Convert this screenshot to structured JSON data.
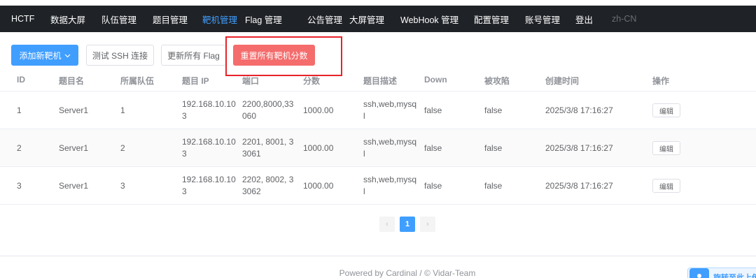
{
  "nav": {
    "brand": "HCTF",
    "items": [
      {
        "label": "数据大屏"
      },
      {
        "label": "队伍管理"
      },
      {
        "label": "题目管理"
      },
      {
        "label": "靶机管理"
      },
      {
        "label": "Flag 管理"
      },
      {
        "label": "公告管理"
      },
      {
        "label": "大屏管理"
      },
      {
        "label": "WebHook 管理"
      },
      {
        "label": "配置管理"
      },
      {
        "label": "账号管理"
      },
      {
        "label": "登出"
      }
    ],
    "active_index": 3,
    "lang": "zh-CN"
  },
  "toolbar": {
    "add_label": "添加新靶机",
    "test_ssh_label": "测试 SSH 连接",
    "update_flags_label": "更新所有 Flag",
    "reset_scores_label": "重置所有靶机分数"
  },
  "table": {
    "headers": [
      "ID",
      "题目名",
      "所属队伍",
      "题目 IP",
      "端口",
      "分数",
      "题目描述",
      "Down",
      "被攻陷",
      "创建时间",
      "操作"
    ],
    "rows": [
      {
        "id": "1",
        "name": "Server1",
        "team": "1",
        "ip_l1": "192.168.10.10",
        "ip_l2": "3",
        "port_l1": "2200,8000,33",
        "port_l2": "060",
        "score": "1000.00",
        "desc_l1": "ssh,web,mysq",
        "desc_l2": "l",
        "down": "false",
        "attacked": "false",
        "created": "2025/3/8 17:16:27",
        "action": "编辑"
      },
      {
        "id": "2",
        "name": "Server1",
        "team": "2",
        "ip_l1": "192.168.10.10",
        "ip_l2": "3",
        "port_l1": "2201, 8001, 3",
        "port_l2": "3061",
        "score": "1000.00",
        "desc_l1": "ssh,web,mysq",
        "desc_l2": "l",
        "down": "false",
        "attacked": "false",
        "created": "2025/3/8 17:16:27",
        "action": "编辑"
      },
      {
        "id": "3",
        "name": "Server1",
        "team": "3",
        "ip_l1": "192.168.10.10",
        "ip_l2": "3",
        "port_l1": "2202, 8002, 3",
        "port_l2": "3062",
        "score": "1000.00",
        "desc_l1": "ssh,web,mysq",
        "desc_l2": "l",
        "down": "false",
        "attacked": "false",
        "created": "2025/3/8 17:16:27",
        "action": "编辑"
      }
    ]
  },
  "pagination": {
    "prev": "‹",
    "current": "1",
    "next": "›"
  },
  "footer": {
    "text": "Powered by Cardinal / © Vidar-Team"
  },
  "floating": {
    "label": "旋转至此上传"
  },
  "colors": {
    "primary": "#409eff",
    "danger": "#f56c6c",
    "nav_bg": "#1f2226",
    "highlight": "#e8222a"
  }
}
